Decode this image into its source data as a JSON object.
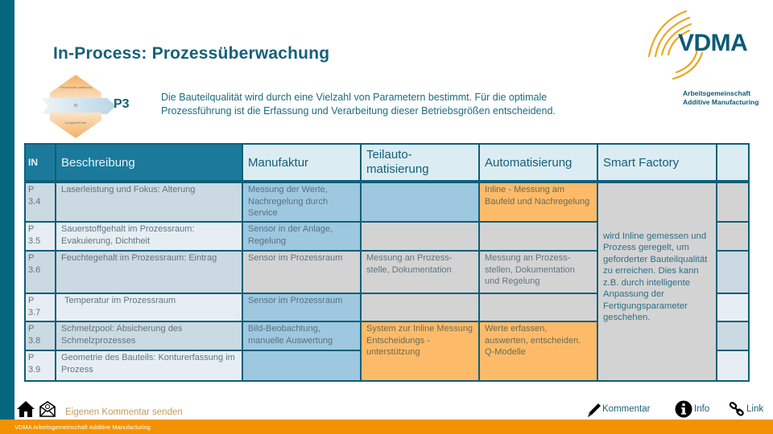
{
  "page": {
    "title": "In-Process: Prozessüberwachung",
    "step_label": "P3",
    "intro_line1": "Die Bauteilqualität wird durch eine Vielzahl von Parametern bestimmt. Für die optimale",
    "intro_line2": "Prozessführung ist die Erfassung und Verarbeitung dieser Betriebsgrößen entscheidend."
  },
  "diagram": {
    "top_label": "Prozessüber-wachung",
    "band_label": "IN",
    "bottom_label": "Ausgabe/Ende"
  },
  "logo": {
    "brand": "VDMA",
    "sub_line1": "Arbeitsgemeinschaft",
    "sub_line2": "Additive Manufacturing",
    "colors": {
      "blue": "#0c5a78",
      "gold": "#e9a825"
    }
  },
  "table": {
    "headers": {
      "id": "IN",
      "description": "Beschreibung",
      "manufaktur": "Manufaktur",
      "teilauto_1": "Teilauto-",
      "teilauto_2": "matisierung",
      "automatisierung": "Automatisierung",
      "smart_factory": "Smart Factory",
      "extra": ""
    },
    "rows": [
      {
        "id_1": "P",
        "id_2": "3.4",
        "description": "Laserleistung und Fokus: Alterung",
        "manufaktur": "Messung der Werte, Nachregelung durch Service",
        "teilauto": "",
        "automatisierung": "Inline - Messung am Baufeld und Nachregelung"
      },
      {
        "id_1": "P",
        "id_2": "3.5",
        "description": "Sauerstoffgehalt im Prozessraum: Evakuierung, Dichtheit",
        "manufaktur": "Sensor in der Anlage, Regelung",
        "teilauto": "",
        "automatisierung": ""
      },
      {
        "id_1": "P",
        "id_2": "3.6",
        "description": "Feuchtegehalt im Prozessraum: Eintrag",
        "manufaktur": "Sensor im Prozessraum",
        "teilauto": "Messung an Prozess-stelle, Dokumentation",
        "automatisierung": "Messung an Prozess-stellen, Dokumentation und Regelung"
      },
      {
        "id_1": "P",
        "id_2": "3.7",
        "description": "Temperatur im Prozessraum",
        "manufaktur": "Sensor im Prozessraum",
        "teilauto": "",
        "automatisierung": ""
      },
      {
        "id_1": "P",
        "id_2": "3.8",
        "description": "Schmelzpool: Absicherung des Schmelzprozesses",
        "manufaktur": "Bild-Beobachtung, manuelle Auswertung",
        "teilauto": "System zur Inline Messung Entscheidungs -unterstützung",
        "automatisierung": "Werte erfassen, auswerten, entscheiden. Q-Modelle"
      },
      {
        "id_1": "P",
        "id_2": "3.9",
        "description": "Geometrie des Bauteils: Konturerfassung im Prozess",
        "manufaktur": ""
      }
    ],
    "smart_factory_text": "wird Inline gemessen und Prozess geregelt, um geforderter Bauteilqualität zu erreichen. Dies kann z.B. durch intelligente Anpassung der Fertigungsparameter geschehen.",
    "cell_colors": {
      "header_dark": "#1b7a9c",
      "header_light": "#dcecf3",
      "blue": "#9ec8df",
      "gray": "#d3d3d3",
      "orange": "#fdbb6a",
      "light": "#e6eef3",
      "mid": "#cbd9e2"
    }
  },
  "footer": {
    "home_icon": "home-icon",
    "mail_icon": "mail-icon",
    "comment_link": "Eigenen Kommentar senden",
    "kommentar_label": "Kommentar",
    "info_label": "Info",
    "link_label": "Link",
    "bar_text": "VDMA   Arbeitsgemeinschaft Additive Manufacturing",
    "bar_color": "#f39200"
  }
}
